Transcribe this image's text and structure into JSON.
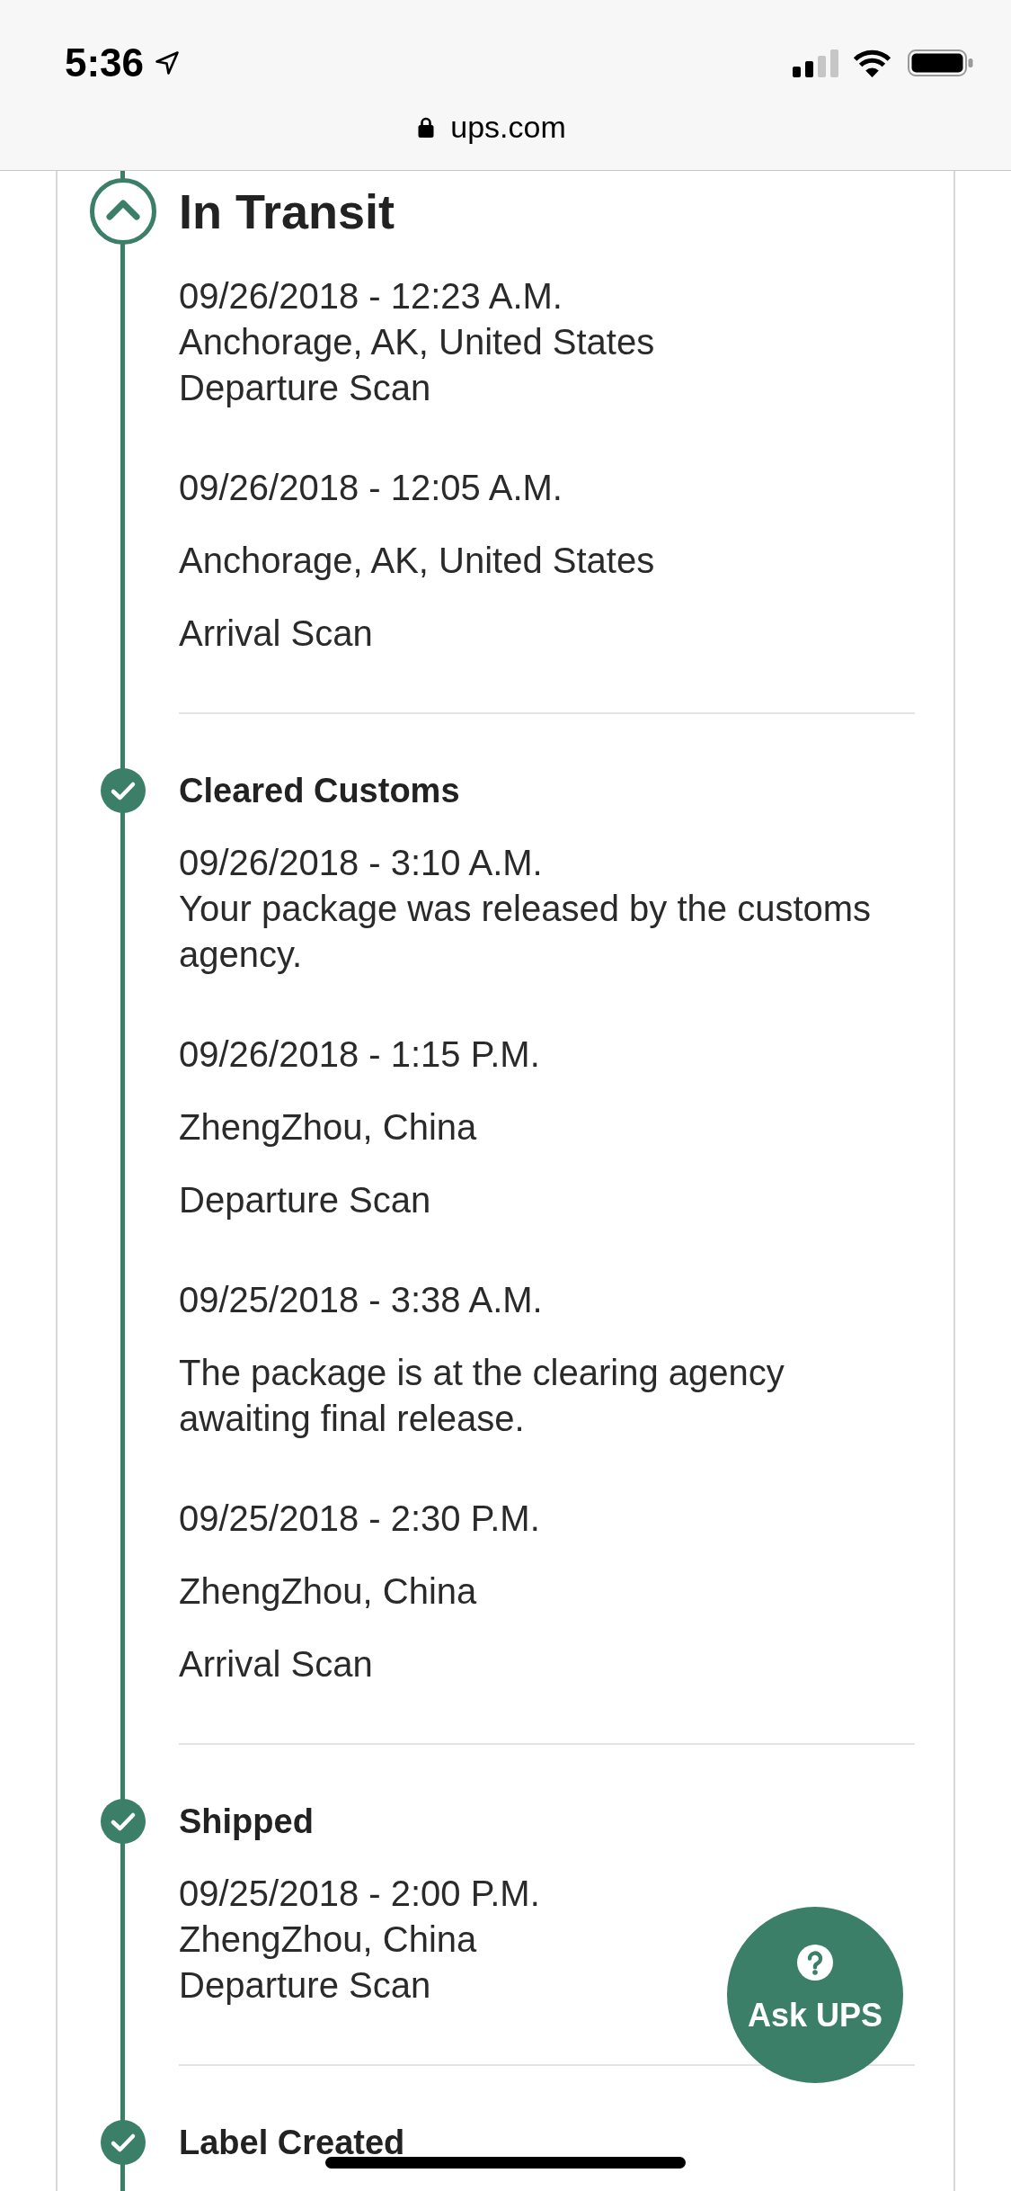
{
  "status_bar": {
    "time": "5:36"
  },
  "address_bar": {
    "url": "ups.com"
  },
  "tracking": {
    "milestones": [
      {
        "title": "In Transit",
        "current": true,
        "events": [
          {
            "kind": "stacked",
            "date": "09/26/2018 - 12:23 A.M.",
            "location": "Anchorage, AK, United States",
            "activity": "Departure Scan"
          },
          {
            "kind": "spaced",
            "date": "09/26/2018 - 12:05 A.M.",
            "location": "Anchorage, AK, United States",
            "activity": "Arrival Scan"
          }
        ]
      },
      {
        "title": "Cleared Customs",
        "current": false,
        "events": [
          {
            "kind": "stacked",
            "date": "09/26/2018 - 3:10 A.M.",
            "activity": "Your package was released by the customs agency."
          },
          {
            "kind": "spaced",
            "date": "09/26/2018 - 1:15 P.M.",
            "location": "ZhengZhou, China",
            "activity": "Departure Scan"
          },
          {
            "kind": "spaced",
            "date": "09/25/2018 - 3:38 A.M.",
            "activity": "The package is at the clearing agency awaiting final release."
          },
          {
            "kind": "spaced",
            "date": "09/25/2018 - 2:30 P.M.",
            "location": "ZhengZhou, China",
            "activity": "Arrival Scan"
          }
        ]
      },
      {
        "title": "Shipped",
        "current": false,
        "events": [
          {
            "kind": "stacked",
            "date": "09/25/2018 - 2:00 P.M.",
            "location": "ZhengZhou, China",
            "activity": "Departure Scan"
          }
        ]
      },
      {
        "title": "Label Created",
        "current": false
      }
    ]
  },
  "chat_button": {
    "label": "Ask UPS"
  }
}
